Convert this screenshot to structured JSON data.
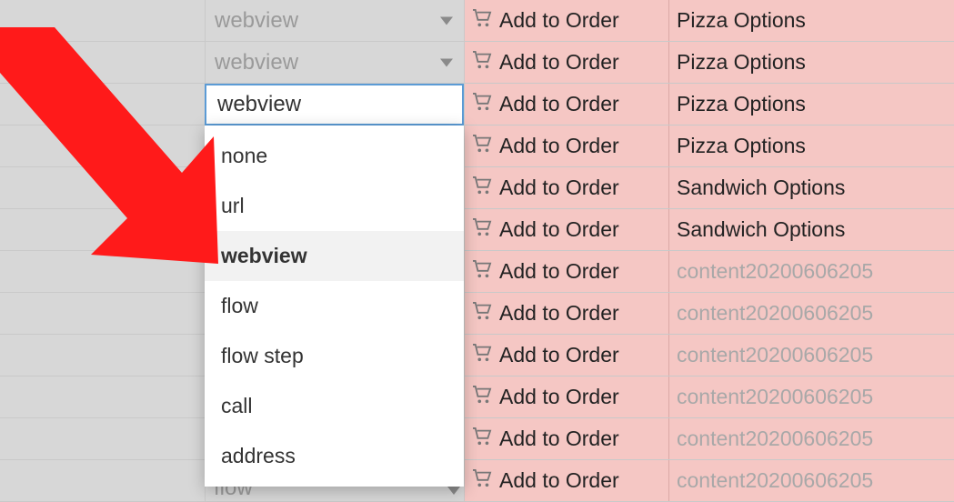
{
  "colors": {
    "arrow": "#ff1a1a",
    "highlight_border": "#5b9bd5",
    "muted_text": "#a8a8a8",
    "cell_bg_pink": "#f5c7c4"
  },
  "input_cell": {
    "value": "webview"
  },
  "visible_select_rows": [
    {
      "label": "webview",
      "show_triangle": true
    },
    {
      "label": "webview",
      "show_triangle": true
    }
  ],
  "ghost_row_label": "flow",
  "dropdown": {
    "options": [
      {
        "label": "none",
        "selected": false
      },
      {
        "label": "url",
        "selected": false
      },
      {
        "label": "webview",
        "selected": true
      },
      {
        "label": "flow",
        "selected": false
      },
      {
        "label": "flow step",
        "selected": false
      },
      {
        "label": "call",
        "selected": false
      },
      {
        "label": "address",
        "selected": false
      }
    ]
  },
  "rows": [
    {
      "order": "Add to Order",
      "option": "Pizza Options",
      "muted": false
    },
    {
      "order": "Add to Order",
      "option": "Pizza Options",
      "muted": false
    },
    {
      "order": "Add to Order",
      "option": "Pizza Options",
      "muted": false
    },
    {
      "order": "Add to Order",
      "option": "Pizza Options",
      "muted": false
    },
    {
      "order": "Add to Order",
      "option": "Sandwich Options",
      "muted": false
    },
    {
      "order": "Add to Order",
      "option": "Sandwich Options",
      "muted": false
    },
    {
      "order": "Add to Order",
      "option": "content20200606205",
      "muted": true
    },
    {
      "order": "Add to Order",
      "option": "content20200606205",
      "muted": true
    },
    {
      "order": "Add to Order",
      "option": "content20200606205",
      "muted": true
    },
    {
      "order": "Add to Order",
      "option": "content20200606205",
      "muted": true
    },
    {
      "order": "Add to Order",
      "option": "content20200606205",
      "muted": true
    },
    {
      "order": "Add to Order",
      "option": "content20200606205",
      "muted": true
    }
  ]
}
